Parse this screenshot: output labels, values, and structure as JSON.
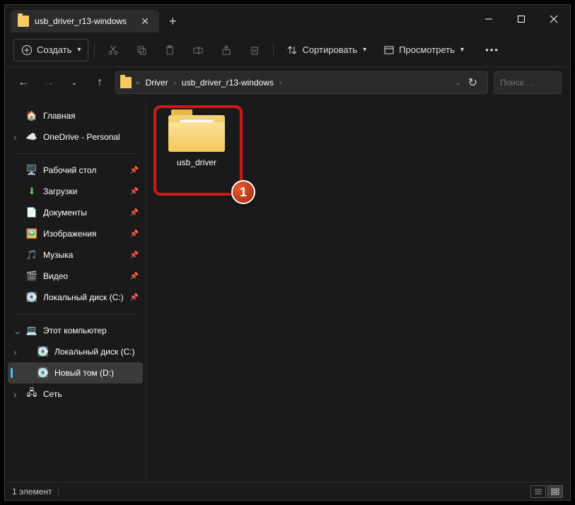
{
  "titlebar": {
    "tab_title": "usb_driver_r13-windows"
  },
  "toolbar": {
    "create": "Создать",
    "sort": "Сортировать",
    "view": "Просмотреть"
  },
  "breadcrumb": {
    "seg1": "Driver",
    "seg2": "usb_driver_r13-windows"
  },
  "search": {
    "placeholder": "Поиск …"
  },
  "sidebar": {
    "home": "Главная",
    "onedrive": "OneDrive - Personal",
    "desktop": "Рабочий стол",
    "downloads": "Загрузки",
    "documents": "Документы",
    "pictures": "Изображения",
    "music": "Музыка",
    "videos": "Видео",
    "localc1": "Локальный диск (C:)",
    "thispc": "Этот компьютер",
    "localc2": "Локальный диск (C:)",
    "newvol": "Новый том (D:)",
    "network": "Сеть"
  },
  "content": {
    "items": [
      {
        "name": "usb_driver"
      }
    ]
  },
  "callout": {
    "num": "1"
  },
  "statusbar": {
    "count": "1 элемент"
  }
}
